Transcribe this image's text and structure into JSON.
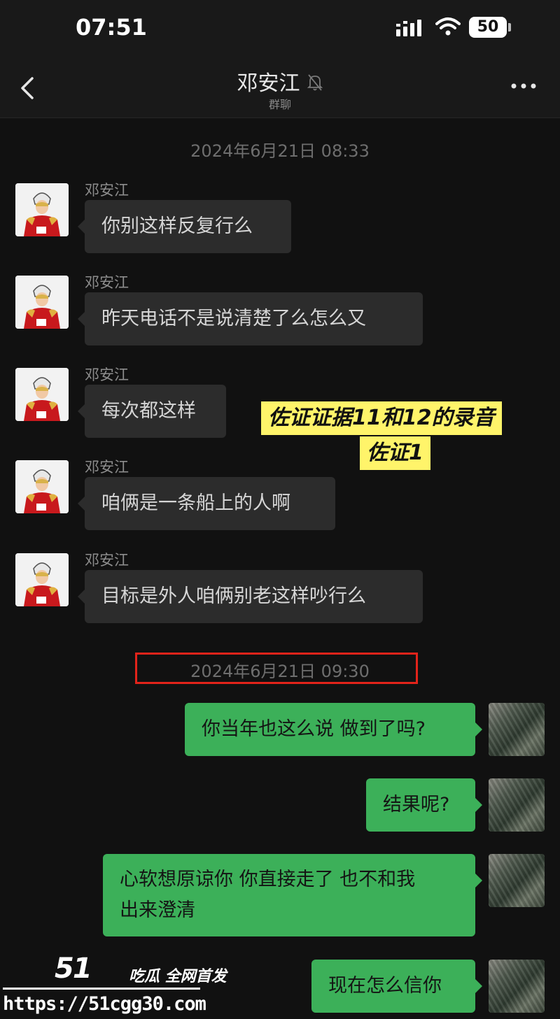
{
  "status_bar": {
    "time": "07:51",
    "battery": "50",
    "icons": [
      "signal-icon",
      "wifi-icon",
      "battery-icon"
    ]
  },
  "header": {
    "title": "邓安江",
    "subtitle": "群聊",
    "icons": [
      "back-icon",
      "mute-bell-icon",
      "more-icon"
    ]
  },
  "messages": {
    "timestamp_1": "2024年6月21日 08:33",
    "timestamp_2": "2024年6月21日 09:30",
    "incoming": [
      {
        "sender": "邓安江",
        "text": "你别这样反复行么"
      },
      {
        "sender": "邓安江",
        "text": "昨天电话不是说清楚了么怎么又"
      },
      {
        "sender": "邓安江",
        "text": "每次都这样"
      },
      {
        "sender": "邓安江",
        "text": "咱俩是一条船上的人啊"
      },
      {
        "sender": "邓安江",
        "text": "目标是外人咱俩别老这样吵行么"
      }
    ],
    "outgoing": [
      {
        "line1": "你当年也这么说 做到了吗?"
      },
      {
        "line1": "结果呢?"
      },
      {
        "line1": "心软想原谅你 你直接走了 也不和我",
        "line2": "出来澄清"
      },
      {
        "line1": "现在怎么信你"
      }
    ]
  },
  "annotation": {
    "line1": "佐证证据11和12的录音",
    "line2": "佐证1",
    "color": "#fff46a"
  },
  "highlight": {
    "color": "#e2231a"
  },
  "watermark": {
    "logo": "51",
    "text": "吃瓜 全网首发",
    "url": "https://51cgg30.com"
  },
  "colors": {
    "background": "#111111",
    "incoming_bubble": "#2c2c2c",
    "outgoing_bubble": "#3cb059"
  }
}
